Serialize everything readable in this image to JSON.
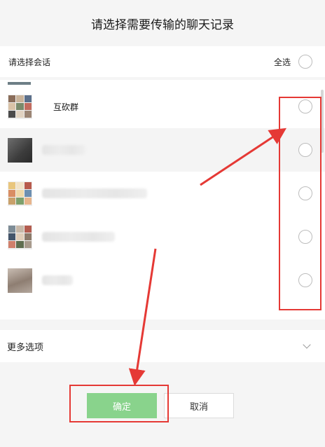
{
  "dialog": {
    "title": "请选择需要传输的聊天记录"
  },
  "list_header": {
    "label": "请选择会话",
    "select_all_label": "全选"
  },
  "chats": [
    {
      "name": "互砍群",
      "selected": false,
      "name_visible": true
    },
    {
      "name": "",
      "selected": false,
      "name_visible": false
    },
    {
      "name": "",
      "selected": false,
      "name_visible": false
    },
    {
      "name": "",
      "selected": false,
      "name_visible": false
    },
    {
      "name": "",
      "selected": false,
      "name_visible": false
    }
  ],
  "more_options": {
    "label": "更多选项",
    "icon": "chevron-down-icon"
  },
  "buttons": {
    "confirm_label": "确定",
    "cancel_label": "取消"
  },
  "colors": {
    "confirm_button": "#89d38c",
    "annotation": "#e53935"
  }
}
